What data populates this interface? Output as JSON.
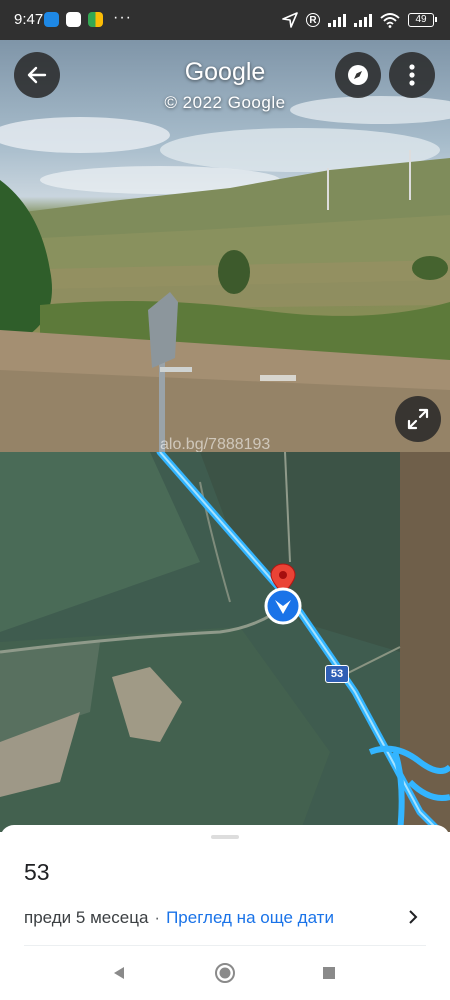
{
  "status_bar": {
    "time": "9:47",
    "battery": "49",
    "more_dots": "···"
  },
  "street_view": {
    "title": "Google",
    "copyright": "© 2022 Google",
    "watermark": "alo.bg/7888193"
  },
  "map": {
    "road_label": "53",
    "accent_route": "#33b5ff",
    "pin_color": "#ea4335",
    "marker_color": "#1a73e8"
  },
  "sheet": {
    "road_title": "53",
    "ago_prefix": "преди",
    "ago_number": "5",
    "ago_unit": "месеца",
    "separator": "·",
    "more_dates_link": "Преглед на още дати"
  }
}
